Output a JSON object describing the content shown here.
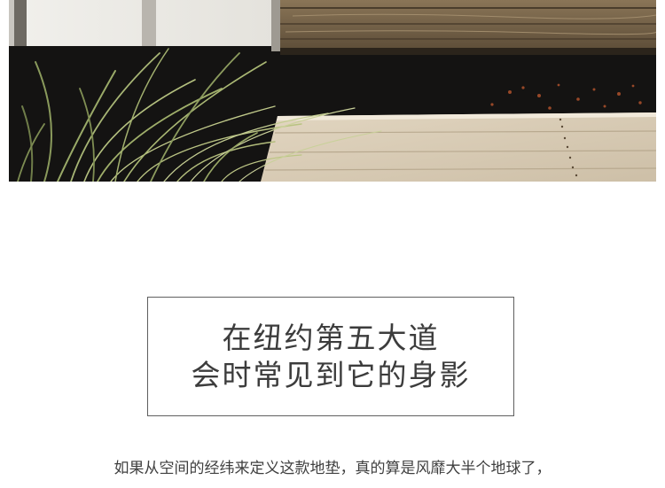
{
  "headline": {
    "line1": "在纽约第五大道",
    "line2": "会时常见到它的身影"
  },
  "body": {
    "paragraph": "如果从空间的经纬来定义这款地垫，真的算是风靡大半个地球了，"
  },
  "colors": {
    "background": "#ffffff",
    "border": "#5f5f5f",
    "heading_text": "#3c3c3c",
    "body_text": "#3f3f3f"
  }
}
